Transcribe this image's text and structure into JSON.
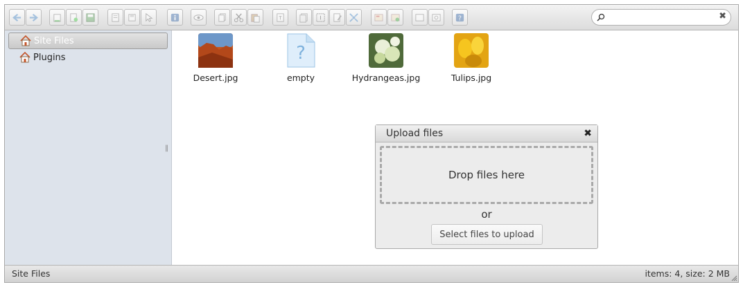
{
  "colors": {
    "sidebar_bg": "#dde3eb",
    "toolbar_bg": "#e6e6e6",
    "active_item_text": "#ffffff",
    "dropzone_border": "#a8a8a8"
  },
  "toolbar": {
    "buttons": [
      "back-icon",
      "forward-icon",
      "up-folder-icon",
      "new-folder-icon",
      "save-icon",
      "open-icon",
      "copy-icon",
      "select-icon",
      "info-icon",
      "preview-icon",
      "duplicate-icon",
      "cut-icon",
      "paste-icon",
      "rename-icon",
      "archive-icon",
      "select-all-icon",
      "edit-icon",
      "resize-icon",
      "view-icon",
      "download-icon",
      "list-view-icon",
      "icons-view-icon",
      "help-icon"
    ]
  },
  "search": {
    "value": "",
    "placeholder": "",
    "clear_icon": "close-icon"
  },
  "sidebar": {
    "items": [
      {
        "label": "Site Files",
        "icon": "home-icon",
        "active": true
      },
      {
        "label": "Plugins",
        "icon": "home-icon",
        "active": false
      }
    ]
  },
  "files": [
    {
      "name": "Desert.jpg",
      "icon": "desert-thumbnail"
    },
    {
      "name": "empty",
      "icon": "unknown-file-icon"
    },
    {
      "name": "Hydrangeas.jpg",
      "icon": "hydrangeas-thumbnail"
    },
    {
      "name": "Tulips.jpg",
      "icon": "tulips-thumbnail"
    }
  ],
  "upload_dialog": {
    "title": "Upload files",
    "drop_text": "Drop files here",
    "or_text": "or",
    "select_label": "Select files to upload"
  },
  "statusbar": {
    "path": "Site Files",
    "info": "items: 4, size: 2 MB"
  }
}
